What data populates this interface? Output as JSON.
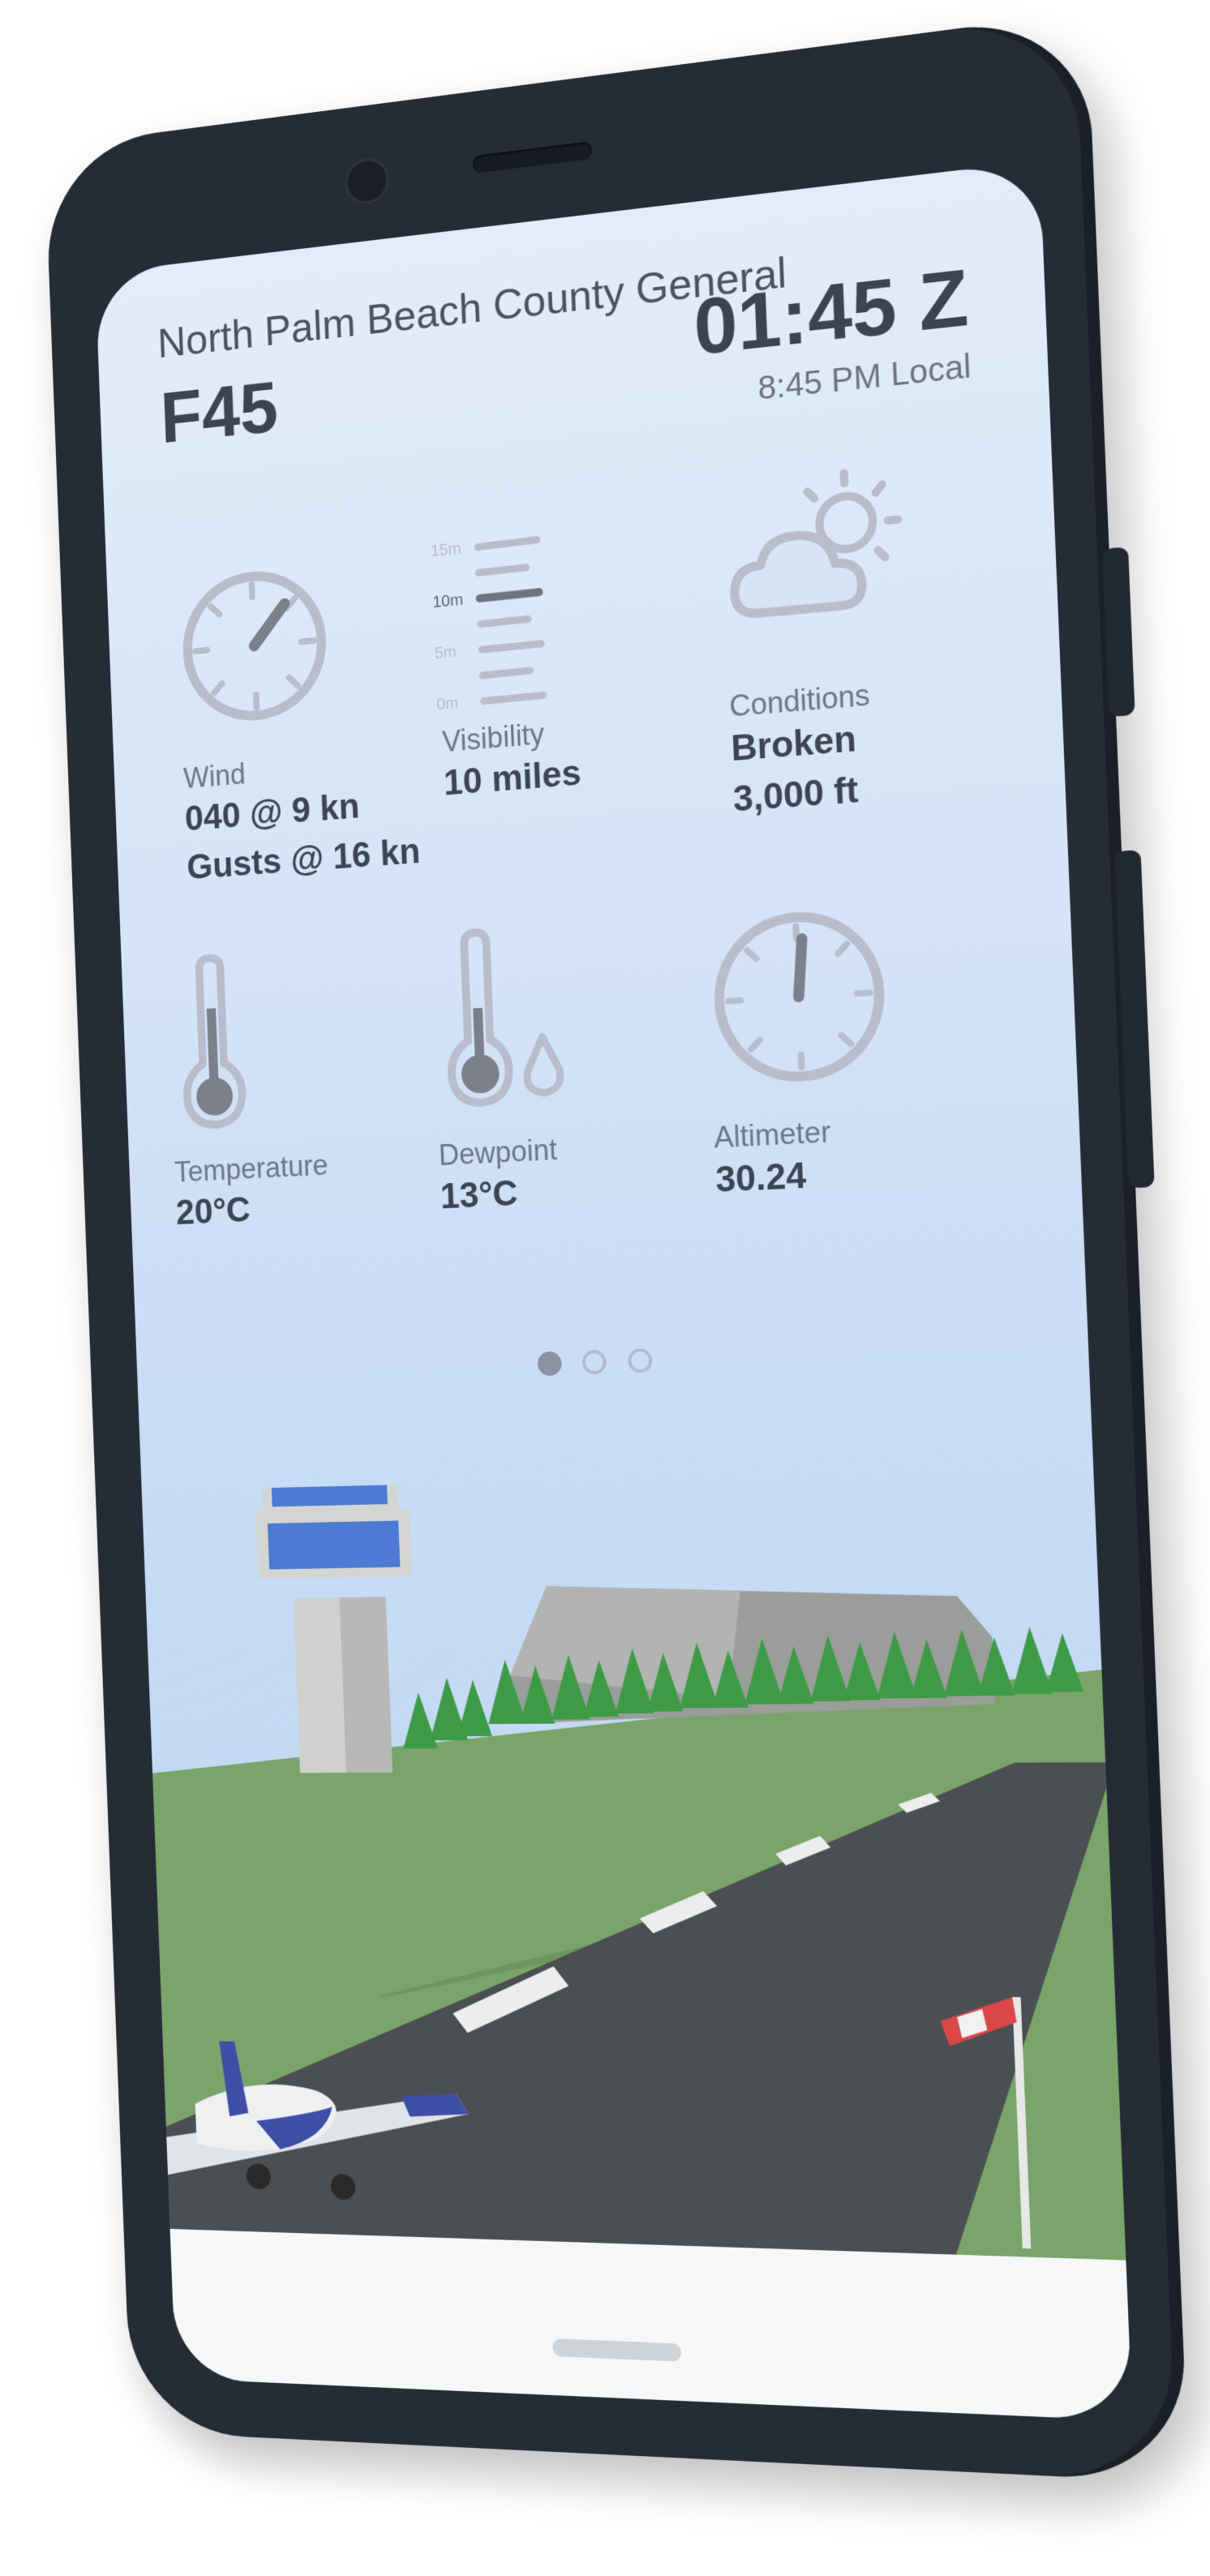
{
  "header": {
    "airport_name": "North Palm Beach County General",
    "airport_code": "F45",
    "zulu_time": "01:45 Z",
    "local_time": "8:45 PM Local"
  },
  "metrics": {
    "wind": {
      "label": "Wind",
      "value_line1": "040 @ 9 kn",
      "value_line2": "Gusts @ 16 kn",
      "icon": "wind-dial-icon",
      "direction_deg": 40
    },
    "visibility": {
      "label": "Visibility",
      "value": "10 miles",
      "icon": "visibility-scale-icon",
      "scale": [
        "15m",
        "10m",
        "5m",
        "0m"
      ],
      "level_miles": 10
    },
    "conditions": {
      "label": "Conditions",
      "value_line1": "Broken",
      "value_line2": "3,000 ft",
      "icon": "partly-cloudy-icon"
    },
    "temperature": {
      "label": "Temperature",
      "value": "20°C",
      "icon": "thermometer-icon"
    },
    "dewpoint": {
      "label": "Dewpoint",
      "value": "13°C",
      "icon": "dewpoint-thermometer-icon"
    },
    "altimeter": {
      "label": "Altimeter",
      "value": "30.24",
      "icon": "altimeter-dial-icon"
    }
  },
  "pager": {
    "pages": 3,
    "active_index": 0
  },
  "scenery": {
    "icons": [
      "control-tower-icon",
      "hangar-icon",
      "airplane-icon",
      "windsock-icon"
    ]
  },
  "colors": {
    "phone_body": "#262c36",
    "sky_top": "#e3ecf9",
    "sky_bottom": "#b9d4f3",
    "text_primary": "#3c4452",
    "icon_gray": "#b8bccb",
    "grass": "#7ba46a",
    "runway": "#4b4f51",
    "plane_accent": "#3f4fa8",
    "windsock": "#d9474a"
  }
}
